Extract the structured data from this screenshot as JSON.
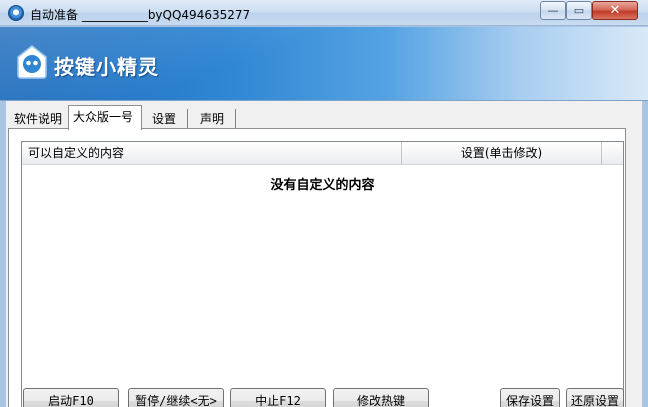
{
  "window": {
    "title": "自动准备 ___________byQQ494635277",
    "minimize_glyph": "—",
    "maximize_glyph": "▭",
    "close_glyph": "✕"
  },
  "banner": {
    "title": "按键小精灵"
  },
  "tabs": [
    {
      "label": "软件说明",
      "active": false
    },
    {
      "label": "大众版一号",
      "active": true
    },
    {
      "label": "设置",
      "active": false
    },
    {
      "label": "声明",
      "active": false
    }
  ],
  "list": {
    "columns": [
      "可以自定义的内容",
      "设置(单击修改)"
    ],
    "empty_message": "没有自定义的内容"
  },
  "buttons": {
    "start": "启动F10",
    "pause": "暂停/继续<无>",
    "stop": "中止F12",
    "hotkey": "修改热键",
    "save": "保存设置",
    "restore": "还原设置"
  },
  "icons": {
    "app": "app-logo-icon",
    "banner": "ghost-logo-icon"
  },
  "colors": {
    "banner_start": "#1e6cbc",
    "banner_end": "#d9e9f8",
    "close_button": "#c23b28"
  }
}
